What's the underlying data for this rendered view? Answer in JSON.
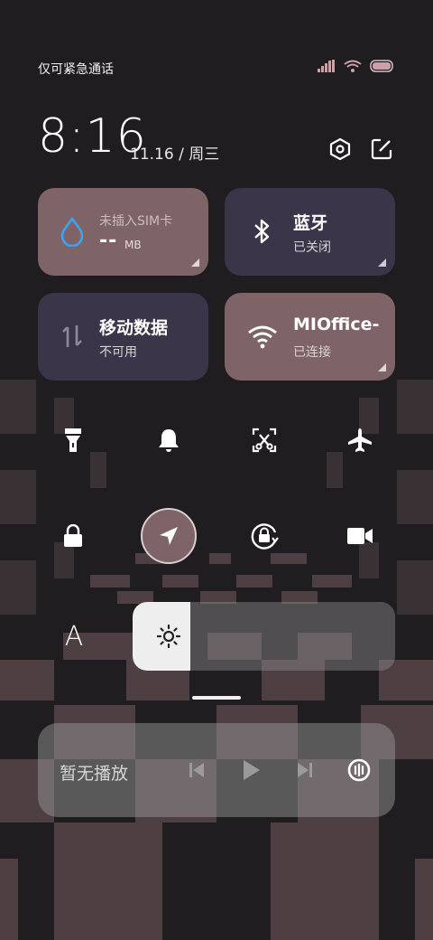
{
  "status_bar": {
    "carrier": "仅可紧急通话",
    "icons": [
      "signal-icon",
      "wifi-icon",
      "battery-icon"
    ]
  },
  "header": {
    "time": "8:16",
    "date": "11.16 / 周三",
    "icons": [
      "settings-icon",
      "edit-icon"
    ]
  },
  "tiles": {
    "data_usage": {
      "title": "未插入SIM卡",
      "value": "--",
      "unit": "MB",
      "icon": "droplet-icon"
    },
    "bluetooth": {
      "title": "蓝牙",
      "status": "已关闭",
      "icon": "bluetooth-icon"
    },
    "mobile_data": {
      "title": "移动数据",
      "status": "不可用",
      "icon": "data-arrows-icon"
    },
    "wifi": {
      "title": "MIOffice-",
      "status": "已连接",
      "icon": "wifi-icon"
    }
  },
  "toggles_row1": [
    "flashlight-icon",
    "bell-icon",
    "screenshot-icon",
    "airplane-icon"
  ],
  "toggles_row2": [
    "lock-icon",
    "location-icon",
    "rotation-lock-icon",
    "video-camera-icon"
  ],
  "brightness": {
    "auto_label": "A",
    "level": 0.22
  },
  "media": {
    "text": "暂无播放",
    "icons": [
      "previous-icon",
      "play-icon",
      "next-icon",
      "cast-icon"
    ]
  },
  "colors": {
    "tile_rose": "#7e6466",
    "tile_purple": "#3b3549",
    "accent_blue": "#3fa2ee",
    "background": "#1f1d1f"
  }
}
